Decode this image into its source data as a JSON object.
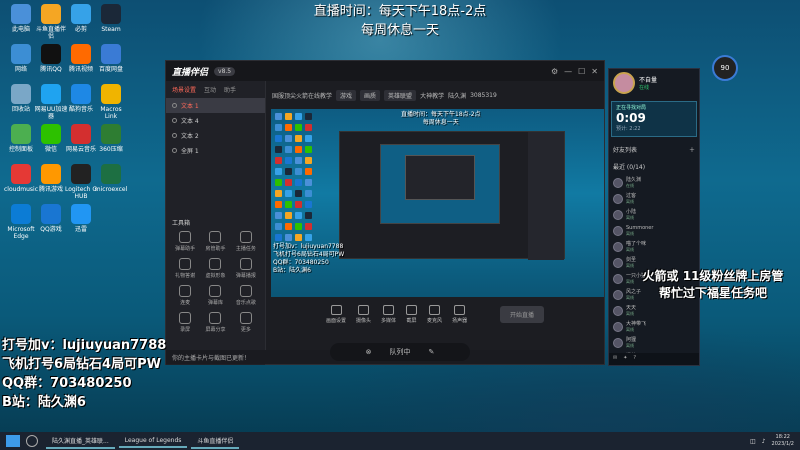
{
  "overlay": {
    "stream_time_line1": "直播时间：每天下午18点-2点",
    "stream_time_line2": "每周休息一天",
    "promo": [
      "打号加v：lujiuyuan7788",
      "飞机打号6局钻石4局可PW",
      "QQ群：703480250",
      "B站：陆久渊6"
    ],
    "fire_msg_line1": "火箭或 11级粉丝牌上房管",
    "fire_msg_line2": "帮忙过下福星任务吧"
  },
  "desktop_icons": [
    {
      "label": "此电脑",
      "color": "#4a90d9"
    },
    {
      "label": "斗鱼直播伴侣",
      "color": "#f5a623"
    },
    {
      "label": "必剪",
      "color": "#36a2e8"
    },
    {
      "label": "Steam",
      "color": "#1b2838"
    },
    {
      "label": "网络",
      "color": "#3c8ed4"
    },
    {
      "label": "腾讯QQ",
      "color": "#111"
    },
    {
      "label": "腾讯视频",
      "color": "#ff6a00"
    },
    {
      "label": "百度网盘",
      "color": "#3a7bd5"
    },
    {
      "label": "回收站",
      "color": "#7aa7c7"
    },
    {
      "label": "网易UU加速器",
      "color": "#1fa3f0"
    },
    {
      "label": "酷狗音乐",
      "color": "#1e88e5"
    },
    {
      "label": "Macros Link",
      "color": "#f0b400"
    },
    {
      "label": "控制面板",
      "color": "#4caf50"
    },
    {
      "label": "微信",
      "color": "#2dc100"
    },
    {
      "label": "网易云音乐",
      "color": "#d32f2f"
    },
    {
      "label": "360压缩",
      "color": "#2e7d32"
    },
    {
      "label": "cloudmusic",
      "color": "#e53935"
    },
    {
      "label": "腾讯游戏",
      "color": "#ff9800"
    },
    {
      "label": "Logitech G HUB",
      "color": "#222"
    },
    {
      "label": "microexcel",
      "color": "#1d6f42"
    },
    {
      "label": "Microsoft Edge",
      "color": "#0c7cd5"
    },
    {
      "label": "QQ游戏",
      "color": "#1976d2"
    },
    {
      "label": "迅雷",
      "color": "#2196f3"
    }
  ],
  "app": {
    "logo": "直播伴侣",
    "version": "v8.5",
    "left_tabs": [
      "场景设置",
      "互动",
      "助手"
    ],
    "scenes": [
      "文本 1",
      "文本 4",
      "文本 2",
      "全屏 1"
    ],
    "tools_title": "工具箱",
    "tools": [
      "弹幕助手",
      "房管助手",
      "主播任务",
      "礼物答谢",
      "虚拟形象",
      "弹幕播报",
      "连麦",
      "弹幕库",
      "音乐点歌",
      "录屏",
      "屏幕分享",
      "更多"
    ],
    "top_scene": "国服顶尖火箭在线教学",
    "top_pill1": "游戏",
    "top_pill2": "画质",
    "top_sub": "英雄联盟",
    "top_sub2": "大神教学",
    "top_viewers": "陆久渊",
    "top_room": "3085319",
    "preview_text1": "直播时间：每天下午18点-2点",
    "preview_text2": "每周休息一天",
    "preview_promo": [
      "打号加v：lujiuyuan7788",
      "飞机打号6局钻石4局可PW",
      "QQ群：703480250",
      "B站：陆久渊6"
    ],
    "bottom_tools": [
      "画面设置",
      "摄像头",
      "多媒体",
      "截屏",
      "麦克风",
      "扬声器"
    ],
    "start_live": "开始直播",
    "tip": "你的主播卡片与截图已更新！",
    "queue_status": "队列中"
  },
  "client": {
    "player_name": "不自量",
    "player_status": "在线",
    "queue_label": "正在寻找对局",
    "queue_time": "0:09",
    "queue_sub": "预计: 2:22",
    "friends_title": "好友列表",
    "group": "最近 (0/14)",
    "friends": [
      {
        "name": "陆久渊",
        "state": "在线"
      },
      {
        "name": "过客",
        "state": "离线"
      },
      {
        "name": "小陆",
        "state": "离线"
      },
      {
        "name": "Summoner",
        "state": "离线"
      },
      {
        "name": "喵了个咪",
        "state": "离线"
      },
      {
        "name": "剑圣",
        "state": "离线"
      },
      {
        "name": "一只小猫",
        "state": "离线"
      },
      {
        "name": "风之子",
        "state": "离线"
      },
      {
        "name": "天天",
        "state": "离线"
      },
      {
        "name": "大神带飞",
        "state": "离线"
      },
      {
        "name": "阿狸",
        "state": "离线"
      },
      {
        "name": "提莫",
        "state": "离线"
      }
    ],
    "badge": "90"
  },
  "taskbar": {
    "items": [
      "陆久渊直播_英雄联...",
      "League of Legends",
      "斗鱼直播伴侣"
    ],
    "time": "18:22",
    "date": "2023/1/2"
  }
}
